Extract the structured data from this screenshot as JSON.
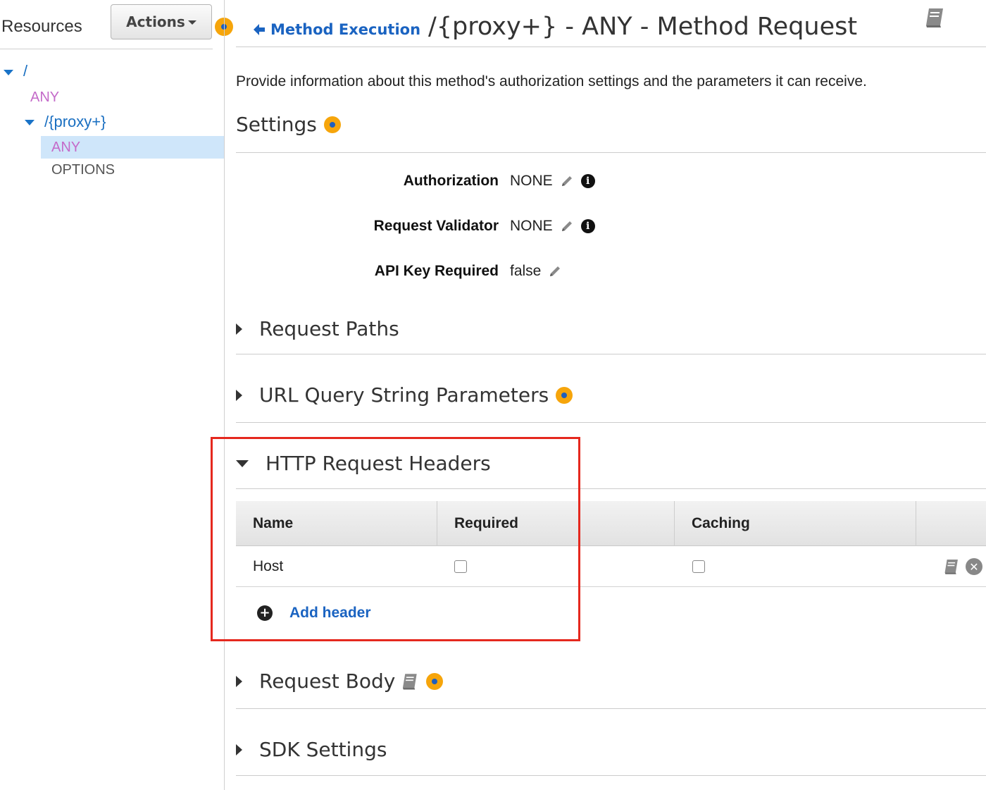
{
  "sidebar": {
    "title": "Resources",
    "actions_label": "Actions",
    "tree": {
      "root_path": "/",
      "root_method": "ANY",
      "proxy_path": "/{proxy+}",
      "proxy_methods": [
        "ANY",
        "OPTIONS"
      ],
      "selected_method": "ANY"
    }
  },
  "header": {
    "back_label": "Method Execution",
    "title": "/{proxy+} - ANY - Method Request"
  },
  "description": "Provide information about this method's authorization settings and the parameters it can receive.",
  "settings": {
    "title": "Settings",
    "rows": [
      {
        "label": "Authorization",
        "value": "NONE",
        "editable": true,
        "info": true
      },
      {
        "label": "Request Validator",
        "value": "NONE",
        "editable": true,
        "info": true
      },
      {
        "label": "API Key Required",
        "value": "false",
        "editable": true,
        "info": false
      }
    ]
  },
  "sections": {
    "request_paths": "Request Paths",
    "url_query": "URL Query String Parameters",
    "http_headers": "HTTP Request Headers",
    "request_body": "Request Body",
    "sdk_settings": "SDK Settings"
  },
  "headers_table": {
    "columns": [
      "Name",
      "Required",
      "Caching"
    ],
    "rows": [
      {
        "name": "Host",
        "required": false,
        "caching": false
      }
    ],
    "add_label": "Add header"
  },
  "colors": {
    "link": "#1a63c1",
    "method_any": "#c46bc9",
    "selected_row": "#cfe6fa",
    "help_dot": "#f6a50b",
    "highlight_box": "#e5281e"
  },
  "icons": [
    "chevron-down-icon",
    "arrow-left-icon",
    "book-icon",
    "help-icon",
    "pencil-icon",
    "info-icon",
    "triangle-right-icon",
    "triangle-down-icon",
    "plus-circle-icon",
    "close-circle-icon"
  ]
}
